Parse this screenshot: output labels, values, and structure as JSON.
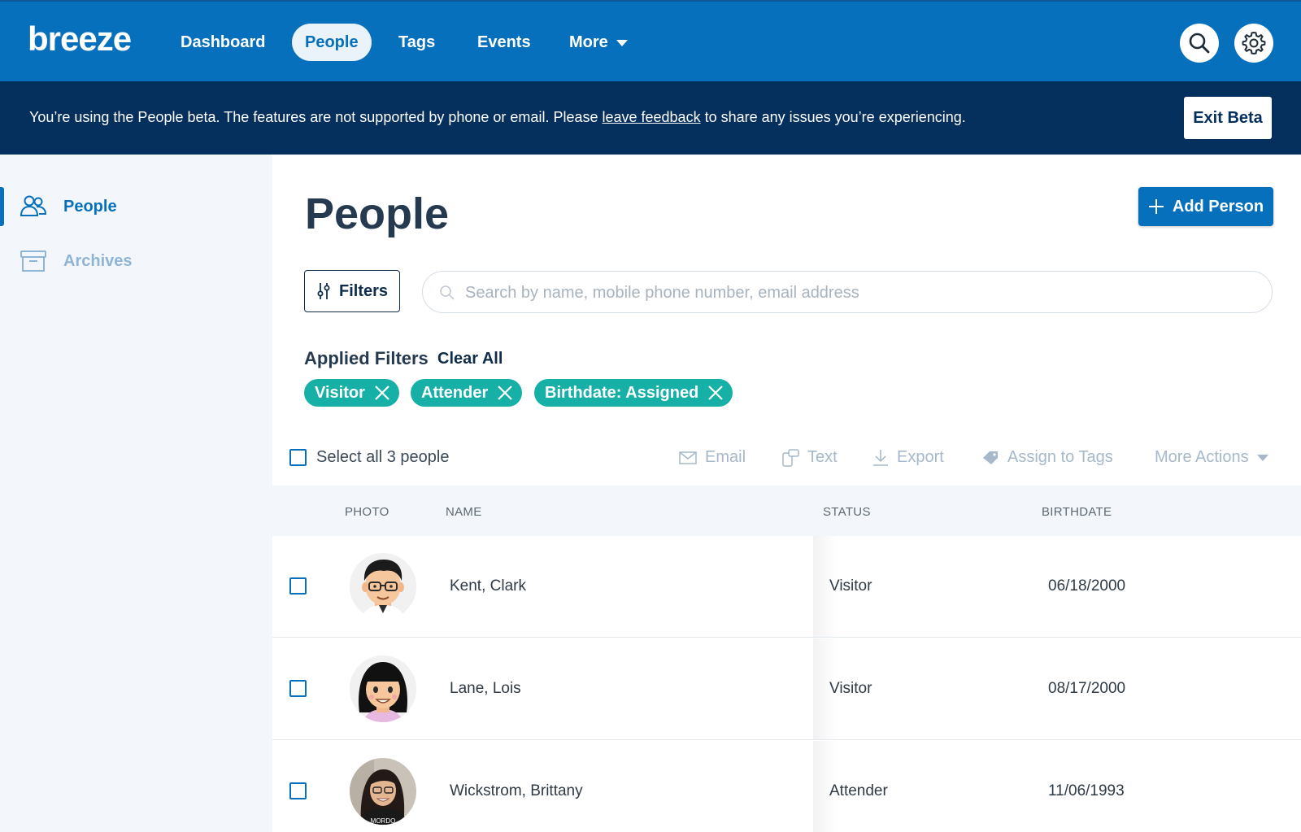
{
  "app": {
    "logo": "breeze"
  },
  "nav": {
    "items": [
      {
        "label": "Dashboard",
        "active": false
      },
      {
        "label": "People",
        "active": true
      },
      {
        "label": "Tags",
        "active": false
      },
      {
        "label": "Events",
        "active": false
      },
      {
        "label": "More",
        "active": false
      }
    ],
    "search_icon": "search-icon",
    "settings_icon": "gear-icon"
  },
  "banner": {
    "text_before": "You’re using the People beta. The features are not supported by phone or email. Please ",
    "link": "leave feedback",
    "text_after": " to share any issues you’re experiencing.",
    "exit_label": "Exit Beta"
  },
  "sidebar": {
    "items": [
      {
        "label": "People",
        "icon": "people-icon",
        "active": true
      },
      {
        "label": "Archives",
        "icon": "archive-icon",
        "active": false
      }
    ]
  },
  "main": {
    "title": "People",
    "add_person_label": "Add Person",
    "filters_label": "Filters",
    "search_placeholder": "Search by name, mobile phone number, email address",
    "applied_filters_label": "Applied Filters",
    "clear_all_label": "Clear All",
    "chips": [
      "Visitor",
      "Attender",
      "Birthdate: Assigned"
    ],
    "select_all_label": "Select all 3 people",
    "actions": [
      {
        "label": "Email",
        "icon": "envelope-icon"
      },
      {
        "label": "Text",
        "icon": "phone-message-icon"
      },
      {
        "label": "Export",
        "icon": "download-icon"
      },
      {
        "label": "Assign to Tags",
        "icon": "tag-icon"
      },
      {
        "label": "More Actions",
        "icon": "chevron-down-icon"
      }
    ]
  },
  "table": {
    "headers": [
      "PHOTO",
      "NAME",
      "STATUS",
      "BIRTHDATE"
    ],
    "rows": [
      {
        "name": "Kent, Clark",
        "status": "Visitor",
        "birthdate": "06/18/2000"
      },
      {
        "name": "Lane, Lois",
        "status": "Visitor",
        "birthdate": "08/17/2000"
      },
      {
        "name": "Wickstrom, Brittany",
        "status": "Attender",
        "birthdate": "11/06/1993"
      }
    ]
  },
  "colors": {
    "brand_blue": "#0670bd",
    "banner_navy": "#05305e",
    "chip_teal": "#16b0a6"
  }
}
